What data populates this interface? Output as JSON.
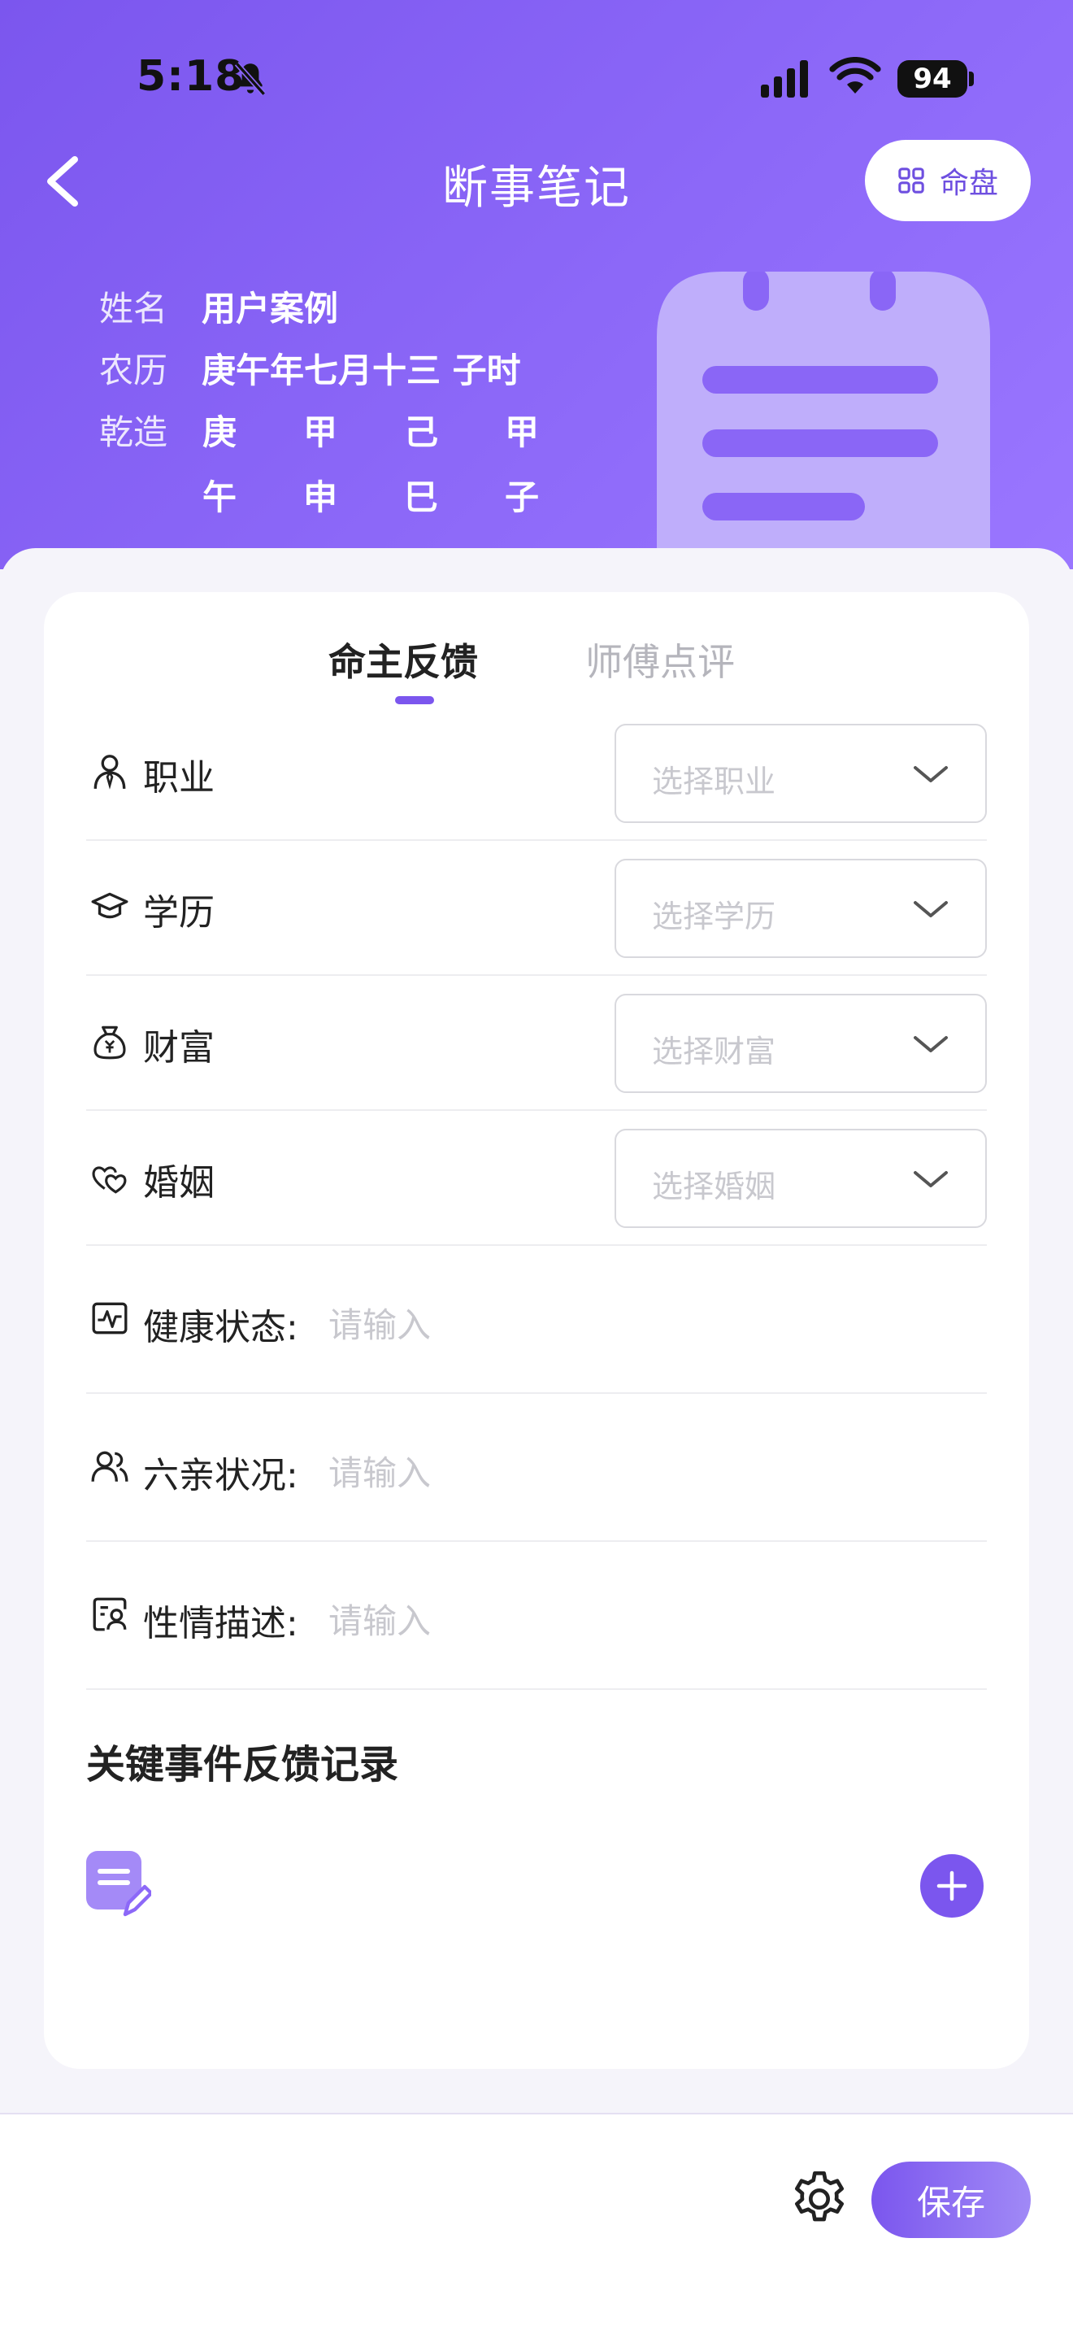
{
  "status_bar": {
    "time": "5:18",
    "battery": "94"
  },
  "header": {
    "title": "断事笔记",
    "chart_button_label": "命盘",
    "info": {
      "name_label": "姓名",
      "name_value": "用户案例",
      "lunar_label": "农历",
      "lunar_value": "庚午年七月十三 子时",
      "bazi_label": "乾造",
      "stems": [
        "庚",
        "甲",
        "己",
        "甲"
      ],
      "branches": [
        "午",
        "申",
        "巳",
        "子"
      ]
    }
  },
  "tabs": [
    {
      "label": "命主反馈",
      "active": true
    },
    {
      "label": "师傅点评",
      "active": false
    }
  ],
  "selects": [
    {
      "label": "职业",
      "placeholder": "选择职业",
      "icon": "person-tie-icon"
    },
    {
      "label": "学历",
      "placeholder": "选择学历",
      "icon": "graduation-cap-icon"
    },
    {
      "label": "财富",
      "placeholder": "选择财富",
      "icon": "money-bag-icon"
    },
    {
      "label": "婚姻",
      "placeholder": "选择婚姻",
      "icon": "hearts-icon"
    }
  ],
  "text_fields": [
    {
      "label": "健康状态:",
      "placeholder": "请输入",
      "icon": "health-chart-icon"
    },
    {
      "label": "六亲状况:",
      "placeholder": "请输入",
      "icon": "people-icon"
    },
    {
      "label": "性情描述:",
      "placeholder": "请输入",
      "icon": "profile-card-icon"
    }
  ],
  "events_section": {
    "title": "关键事件反馈记录"
  },
  "bottom_bar": {
    "save_label": "保存"
  },
  "colors": {
    "accent": "#7B56EE",
    "header_gradient_start": "#7B56EE",
    "header_gradient_end": "#9A76FF"
  }
}
